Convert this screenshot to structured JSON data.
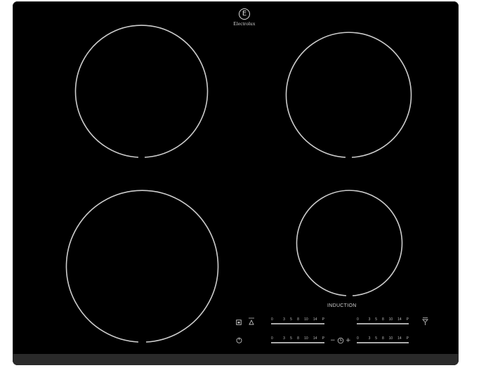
{
  "brand": {
    "name": "Electrolux",
    "mark": "E"
  },
  "panel": {
    "label": "INDUCTION"
  },
  "sliders": [
    {
      "ticks": [
        "0",
        "",
        "3",
        "5",
        "8",
        "10",
        "14",
        "P"
      ]
    },
    {
      "ticks": [
        "0",
        "",
        "3",
        "5",
        "8",
        "10",
        "14",
        "P"
      ]
    },
    {
      "ticks": [
        "0",
        "",
        "3",
        "5",
        "8",
        "10",
        "14",
        "P"
      ]
    },
    {
      "ticks": [
        "0",
        "",
        "3",
        "5",
        "8",
        "10",
        "14",
        "P"
      ]
    }
  ],
  "timer": {
    "minus": "−",
    "plus": "+"
  },
  "icons": {
    "lock": "lock-icon",
    "stop_go": "stop-go-icon",
    "power": "power-icon",
    "timer": "timer-icon",
    "bridge": "bridge-icon"
  }
}
